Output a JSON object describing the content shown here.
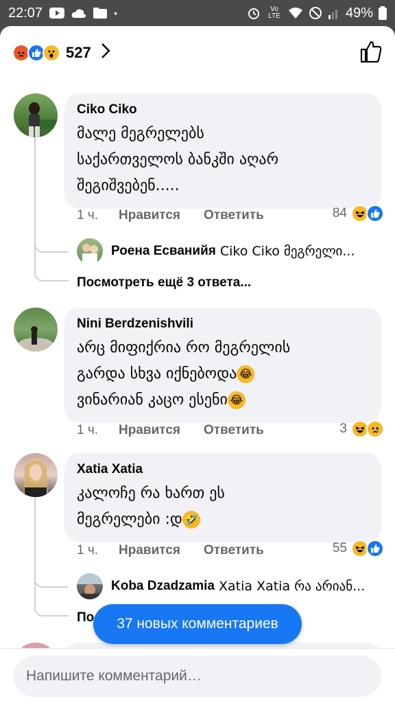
{
  "status": {
    "time": "22:07",
    "battery": "49%",
    "carrier": "Vo LTE"
  },
  "header": {
    "reactions_count": "527",
    "icons": [
      "angry-icon",
      "like-icon",
      "wow-icon"
    ]
  },
  "comments": [
    {
      "author": "Ciko Ciko",
      "text_lines": [
        "მალე მეგრელებს",
        "საქართველოს ბანკში აღარ",
        "შეგიშვებენ....."
      ],
      "time": "1 ч.",
      "like": "Нравится",
      "reply": "Ответить",
      "count": "84",
      "reply_preview": {
        "name": "Роена Есванийя",
        "text": "Ciko Ciko მეგრელი..."
      },
      "more": "Посмотреть ещё 3 ответа..."
    },
    {
      "author": "Nini Berdzenishvili",
      "text_lines": [
        "არც მიფიქრია რო მეგრელის",
        "გარდა სხვა იქნებოდა￼",
        "ვინარიან კაცო ესენი"
      ],
      "time": "1 ч.",
      "like": "Нравится",
      "reply": "Ответить",
      "count": "3"
    },
    {
      "author": "Xatia Xatia",
      "text_lines": [
        "კალოჩე რა ხართ ეს",
        "მეგრელები :დ"
      ],
      "time": "1 ч.",
      "like": "Нравится",
      "reply": "Ответить",
      "count": "55",
      "reply_preview": {
        "name": "Koba Dzadzamia",
        "text": "Xatia Xatia რა არიან..."
      },
      "more": "По"
    }
  ],
  "new_comments": "37 новых комментариев",
  "composer": {
    "placeholder": "Напишите комментарий…"
  },
  "colors": {
    "accent": "#1877f2",
    "bubble": "#f0f2f5",
    "muted": "#65676b"
  }
}
